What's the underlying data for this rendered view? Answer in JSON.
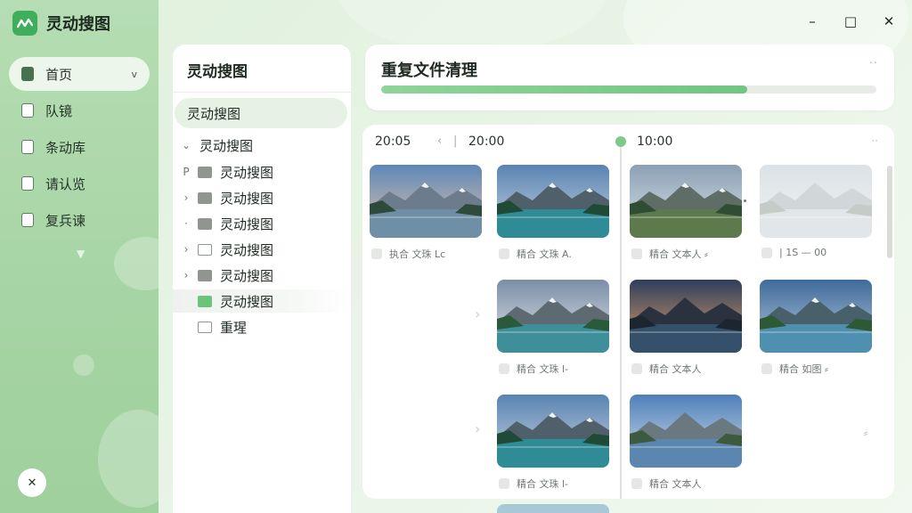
{
  "app": {
    "title": "灵动搜图"
  },
  "sidebar": {
    "items": [
      {
        "label": "首页",
        "active": true,
        "caret": "v"
      },
      {
        "label": "队镜"
      },
      {
        "label": "条动库"
      },
      {
        "label": "请认览"
      },
      {
        "label": "复兵谏"
      }
    ],
    "footer_icon": "✕"
  },
  "window_controls": {
    "minimize": "–",
    "maximize": "□",
    "close": "✕"
  },
  "folder_panel": {
    "title": "灵动搜图",
    "selected": "灵动搜图",
    "tree": [
      {
        "arrow": "⌄",
        "folder": "none",
        "label": "灵动搜图"
      },
      {
        "arrow": "P",
        "folder": "filled",
        "label": "灵动搜图"
      },
      {
        "arrow": "›",
        "folder": "filled",
        "label": "灵动搜图"
      },
      {
        "arrow": "·",
        "folder": "filled",
        "label": "灵动搜图"
      },
      {
        "arrow": "›",
        "folder": "outline",
        "label": "灵动搜图"
      },
      {
        "arrow": "›",
        "folder": "filled",
        "label": "灵动搜图"
      },
      {
        "arrow": "",
        "folder": "green",
        "label": "灵动搜图",
        "highlight": true
      },
      {
        "arrow": "",
        "folder": "outline",
        "label": "重瑆"
      }
    ]
  },
  "header": {
    "title": "重复文件清理",
    "more": "··",
    "progress": 0.74
  },
  "gallery": {
    "time_left": "20:05",
    "nav_prev": "‹",
    "nav_sep": "|",
    "time_mid": "20:00",
    "time_right": "10:00",
    "more": "··",
    "row_chevron": "›",
    "edge_mark": "⸗",
    "photos": [
      {
        "label": "执合 文珠 Lc",
        "scene": "lake-dusk"
      },
      {
        "label": "精合 文珠 A.",
        "scene": "fjord"
      },
      {
        "label": "精合 文本人 ⸗",
        "scene": "valley-path"
      },
      {
        "label": "| 1S — 00",
        "scene": "misty",
        "faded": true
      },
      {
        "label": "精合 文珠 l-",
        "scene": "cloud-lake"
      },
      {
        "label": "精合 文本人",
        "scene": "sunset"
      },
      {
        "label": "精合 如图 ⸗",
        "scene": "river-bend"
      },
      {
        "label": "精合 文珠 l-",
        "scene": "fjord"
      },
      {
        "label": "精合 文本人",
        "scene": "calm-lake"
      }
    ]
  }
}
